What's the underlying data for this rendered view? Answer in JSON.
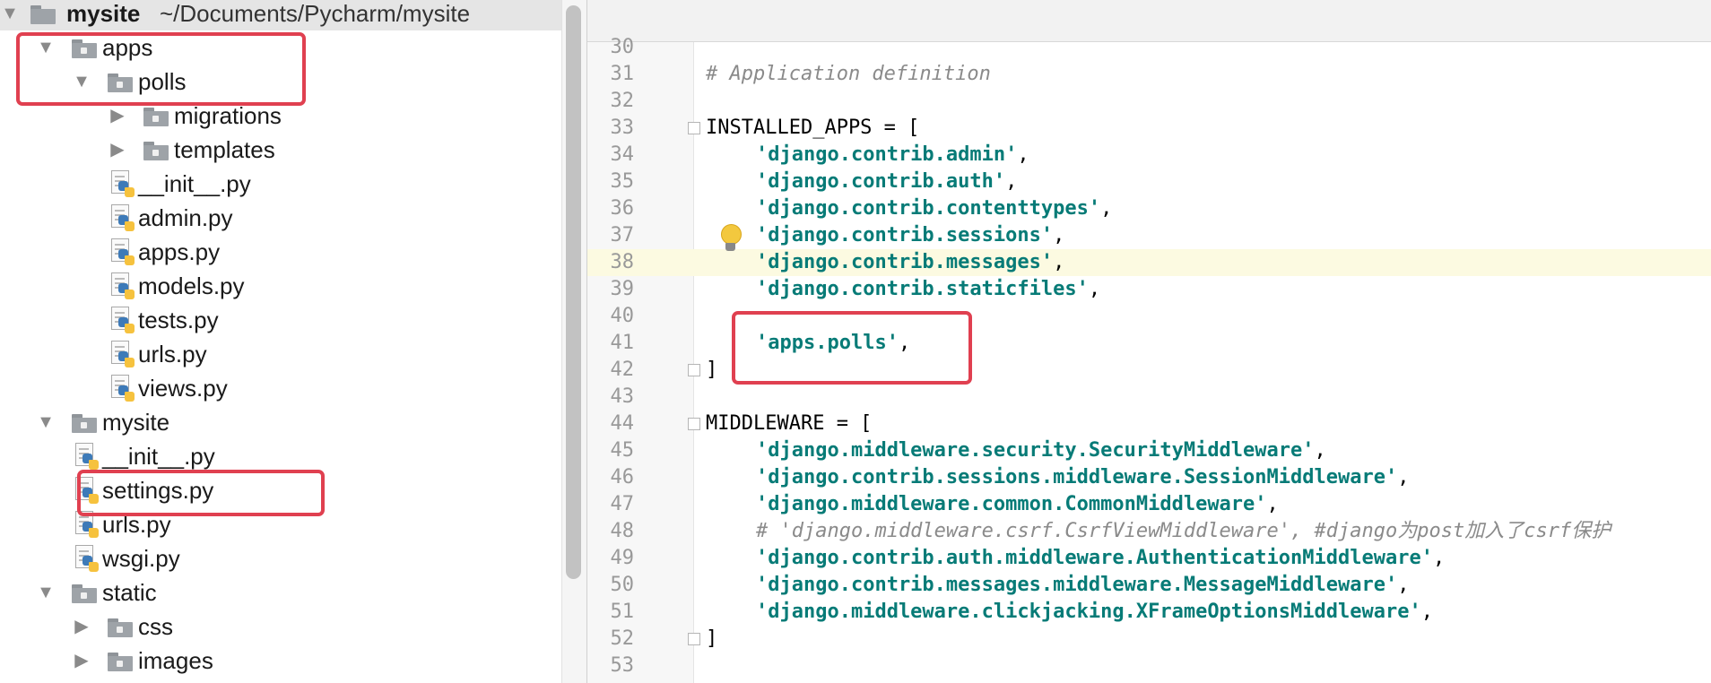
{
  "project_tree": {
    "root": {
      "name": "mysite",
      "path": "~/Documents/Pycharm/mysite"
    },
    "items": [
      {
        "label": "apps",
        "type": "folder",
        "level": 1,
        "expanded": true
      },
      {
        "label": "polls",
        "type": "folder",
        "level": 2,
        "expanded": true
      },
      {
        "label": "migrations",
        "type": "folder",
        "level": 3,
        "expanded": false
      },
      {
        "label": "templates",
        "type": "folder",
        "level": 3,
        "expanded": false
      },
      {
        "label": "__init__.py",
        "type": "python-file",
        "level": 3
      },
      {
        "label": "admin.py",
        "type": "python-file",
        "level": 3
      },
      {
        "label": "apps.py",
        "type": "python-file",
        "level": 3
      },
      {
        "label": "models.py",
        "type": "python-file",
        "level": 3
      },
      {
        "label": "tests.py",
        "type": "python-file",
        "level": 3
      },
      {
        "label": "urls.py",
        "type": "python-file",
        "level": 3
      },
      {
        "label": "views.py",
        "type": "python-file",
        "level": 3
      },
      {
        "label": "mysite",
        "type": "folder",
        "level": 1,
        "expanded": true
      },
      {
        "label": "__init__.py",
        "type": "python-file",
        "level": 2
      },
      {
        "label": "settings.py",
        "type": "python-file",
        "level": 2
      },
      {
        "label": "urls.py",
        "type": "python-file",
        "level": 2
      },
      {
        "label": "wsgi.py",
        "type": "python-file",
        "level": 2
      },
      {
        "label": "static",
        "type": "folder",
        "level": 1,
        "expanded": true
      },
      {
        "label": "css",
        "type": "folder",
        "level": 2,
        "expanded": false
      },
      {
        "label": "images",
        "type": "folder",
        "level": 2,
        "expanded": false
      }
    ]
  },
  "editor": {
    "current_line": "38",
    "lines": [
      {
        "num": "30",
        "text": "",
        "kind": "plain"
      },
      {
        "num": "31",
        "text": "# Application definition",
        "kind": "comment"
      },
      {
        "num": "32",
        "text": "",
        "kind": "plain"
      },
      {
        "num": "33",
        "text": "INSTALLED_APPS = [",
        "kind": "plain",
        "fold": "open"
      },
      {
        "num": "34",
        "text": "'django.contrib.admin'",
        "suffix": ",",
        "kind": "string",
        "indent": 4
      },
      {
        "num": "35",
        "text": "'django.contrib.auth'",
        "suffix": ",",
        "kind": "string",
        "indent": 4
      },
      {
        "num": "36",
        "text": "'django.contrib.contenttypes'",
        "suffix": ",",
        "kind": "string",
        "indent": 4
      },
      {
        "num": "37",
        "text": "'django.contrib.sessions'",
        "suffix": ",",
        "kind": "string",
        "indent": 4
      },
      {
        "num": "38",
        "text": "'django.contrib.messages'",
        "suffix": ",",
        "kind": "string",
        "indent": 4
      },
      {
        "num": "39",
        "text": "'django.contrib.staticfiles'",
        "suffix": ",",
        "kind": "string",
        "indent": 4
      },
      {
        "num": "40",
        "text": "",
        "kind": "plain"
      },
      {
        "num": "41",
        "text": "'apps.polls'",
        "suffix": ",",
        "kind": "string",
        "indent": 4
      },
      {
        "num": "42",
        "text": "]",
        "kind": "plain",
        "fold": "close"
      },
      {
        "num": "43",
        "text": "",
        "kind": "plain"
      },
      {
        "num": "44",
        "text": "MIDDLEWARE = [",
        "kind": "plain",
        "fold": "open"
      },
      {
        "num": "45",
        "text": "'django.middleware.security.SecurityMiddleware'",
        "suffix": ",",
        "kind": "string",
        "indent": 4
      },
      {
        "num": "46",
        "text": "'django.contrib.sessions.middleware.SessionMiddleware'",
        "suffix": ",",
        "kind": "string",
        "indent": 4
      },
      {
        "num": "47",
        "text": "'django.middleware.common.CommonMiddleware'",
        "suffix": ",",
        "kind": "string",
        "indent": 4
      },
      {
        "num": "48",
        "text": "# 'django.middleware.csrf.CsrfViewMiddleware', #django为post加入了csrf保护",
        "kind": "comment",
        "indent": 4
      },
      {
        "num": "49",
        "text": "'django.contrib.auth.middleware.AuthenticationMiddleware'",
        "suffix": ",",
        "kind": "string",
        "indent": 4
      },
      {
        "num": "50",
        "text": "'django.contrib.messages.middleware.MessageMiddleware'",
        "suffix": ",",
        "kind": "string",
        "indent": 4
      },
      {
        "num": "51",
        "text": "'django.middleware.clickjacking.XFrameOptionsMiddleware'",
        "suffix": ",",
        "kind": "string",
        "indent": 4
      },
      {
        "num": "52",
        "text": "]",
        "kind": "plain",
        "fold": "close"
      },
      {
        "num": "53",
        "text": "",
        "kind": "plain"
      }
    ]
  },
  "colors": {
    "string": "#077b77",
    "comment": "#8a8a8a",
    "highlight_box": "#e04050",
    "current_line_bg": "#fcfae1",
    "tree_root_bg": "#e5e5e5"
  }
}
